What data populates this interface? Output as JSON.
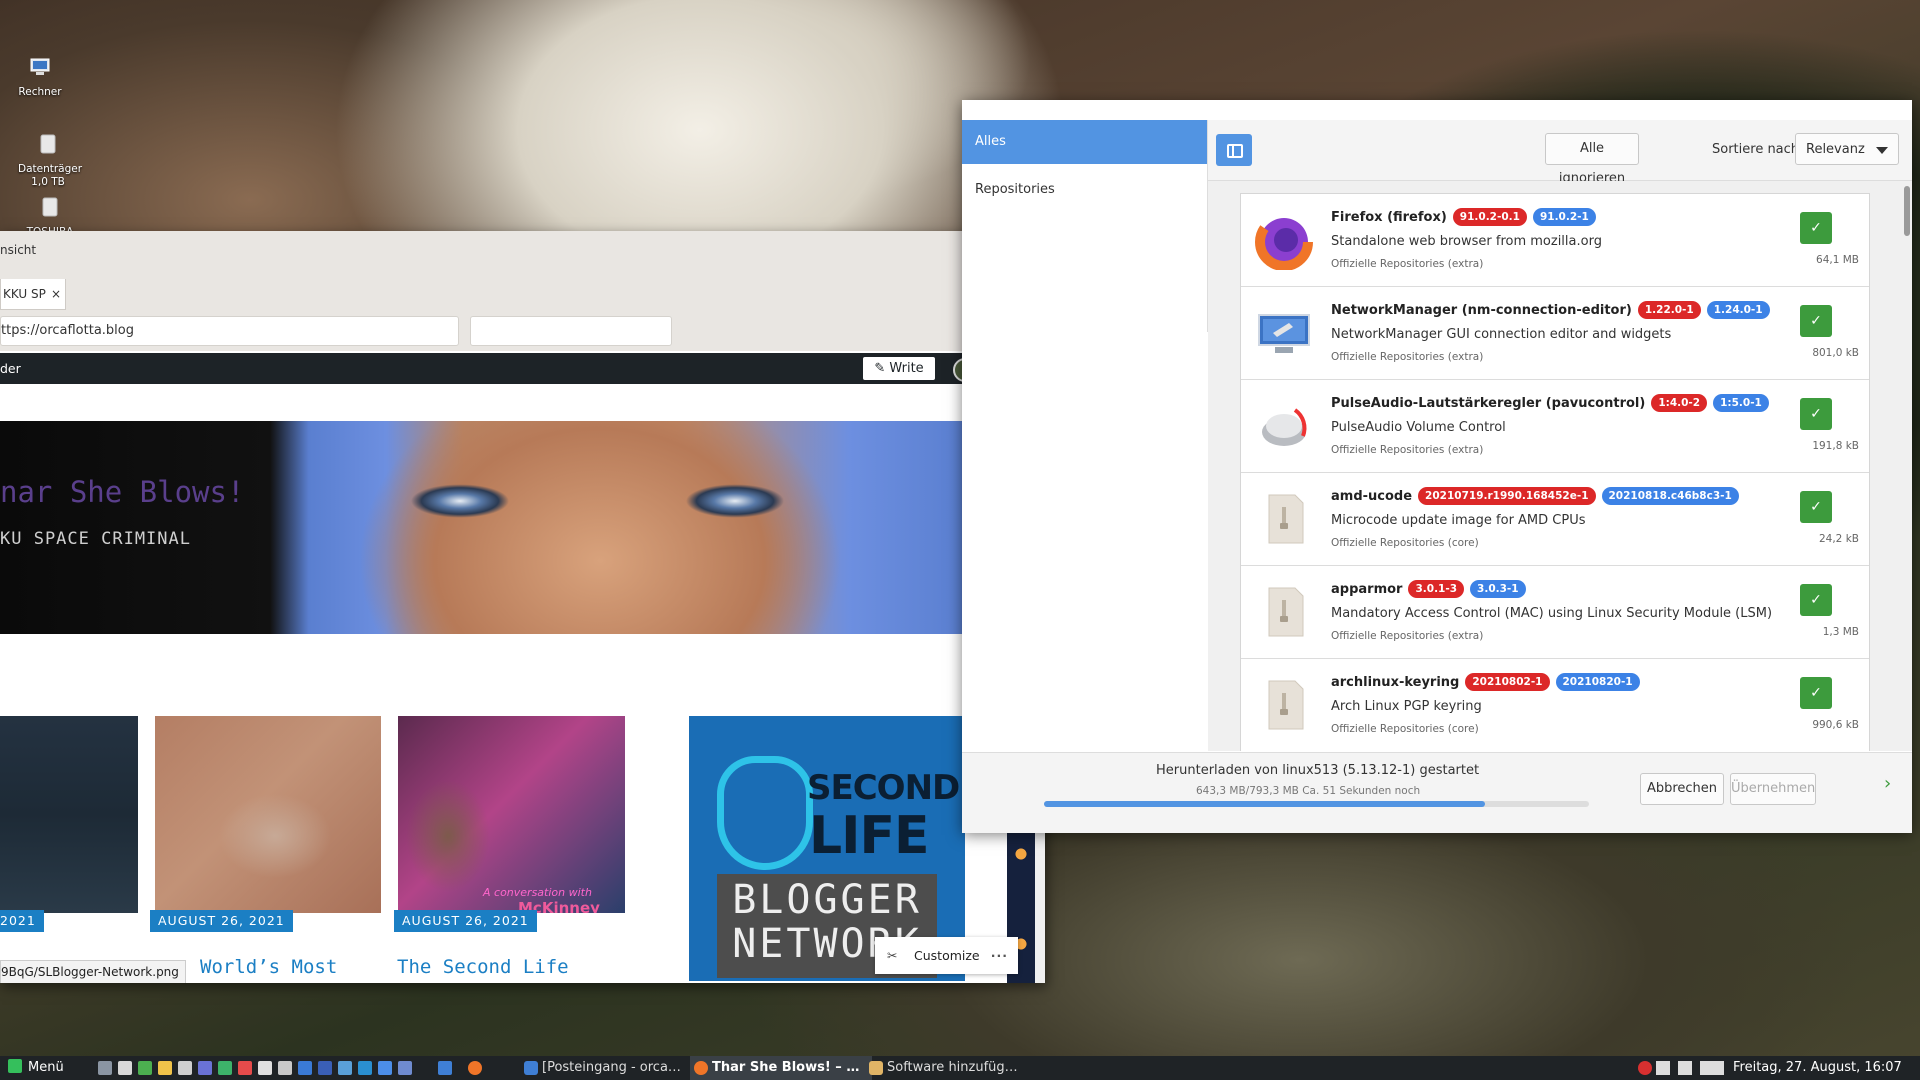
{
  "desktop": {
    "icons": [
      {
        "label": "Rechner"
      },
      {
        "label": "Datenträger 1,0 TB"
      },
      {
        "label": "TOSHIBA EXT"
      }
    ]
  },
  "browser": {
    "menu_fragment": "nsicht",
    "tab_title": "KKU SP",
    "tab_close": "×",
    "url": "ttps://orcaflotta.blog",
    "wp_bar": {
      "reader_label": "der",
      "write_label": "Write"
    },
    "hero": {
      "title": "nar She Blows!",
      "subtitle": "KU SPACE CRIMINAL"
    },
    "posts": [
      {
        "date": "2021",
        "title": ""
      },
      {
        "date": "AUGUST 26, 2021",
        "title": "World’s Most"
      },
      {
        "date": "AUGUST 26, 2021",
        "title": "The Second Life",
        "caption_line1": "A conversation with",
        "caption_line2": "McKinney"
      },
      {
        "logo_word1": "SECOND",
        "logo_word2": "LIFE",
        "logo_word3": "BLOGGER",
        "logo_word4": "NETWORK"
      }
    ],
    "status_url": "9BqG/SLBlogger-Network.png",
    "customize_label": "Customize",
    "customize_more": "···"
  },
  "pamac": {
    "sidebar": {
      "items": [
        "Alles",
        "Repositories"
      ]
    },
    "header": {
      "ignore_all": "Alle ignorieren",
      "sort_label": "Sortiere nach",
      "sort_value": "Relevanz"
    },
    "packages": [
      {
        "name": "Firefox (firefox)",
        "old": "91.0.2-0.1",
        "new": "91.0.2-1",
        "desc": "Standalone web browser from mozilla.org",
        "repo": "Offizielle Repositories (extra)",
        "size": "64,1 MB",
        "icon": "firefox-icon"
      },
      {
        "name": "NetworkManager (nm-connection-editor)",
        "old": "1.22.0-1",
        "new": "1.24.0-1",
        "desc": "NetworkManager GUI connection editor and widgets",
        "repo": "Offizielle Repositories (extra)",
        "size": "801,0 kB",
        "icon": "network-icon"
      },
      {
        "name": "PulseAudio-Lautstärkeregler (pavucontrol)",
        "old": "1:4.0-2",
        "new": "1:5.0-1",
        "desc": "PulseAudio Volume Control",
        "repo": "Offizielle Repositories (extra)",
        "size": "191,8 kB",
        "icon": "volume-icon"
      },
      {
        "name": "amd-ucode",
        "old": "20210719.r1990.168452e-1",
        "new": "20210818.c46b8c3-1",
        "desc": "Microcode update image for AMD CPUs",
        "repo": "Offizielle Repositories (core)",
        "size": "24,2 kB",
        "icon": "package-icon"
      },
      {
        "name": "apparmor",
        "old": "3.0.1-3",
        "new": "3.0.3-1",
        "desc": "Mandatory Access Control (MAC) using Linux Security Module (LSM)",
        "repo": "Offizielle Repositories (extra)",
        "size": "1,3 MB",
        "icon": "package-icon"
      },
      {
        "name": "archlinux-keyring",
        "old": "20210802-1",
        "new": "20210820-1",
        "desc": "Arch Linux PGP keyring",
        "repo": "Offizielle Repositories (core)",
        "size": "990,6 kB",
        "icon": "package-icon"
      }
    ],
    "footer": {
      "status": "Herunterladen von linux513 (5.13.12-1) gestartet",
      "detail": "643,3 MB/793,3 MB Ca. 51 Sekunden noch",
      "progress_fraction": 0.81,
      "cancel": "Abbrechen",
      "apply": "Übernehmen",
      "next_arrow": "›"
    }
  },
  "taskbar": {
    "menu_label": "Menü",
    "tasks": [
      {
        "label": "[Posteingang - orca…",
        "active": false
      },
      {
        "label": "Thar She Blows! – …",
        "active": true
      },
      {
        "label": "Software hinzufüg…",
        "active": false
      }
    ],
    "clock": "Freitag, 27. August, 16:07"
  }
}
